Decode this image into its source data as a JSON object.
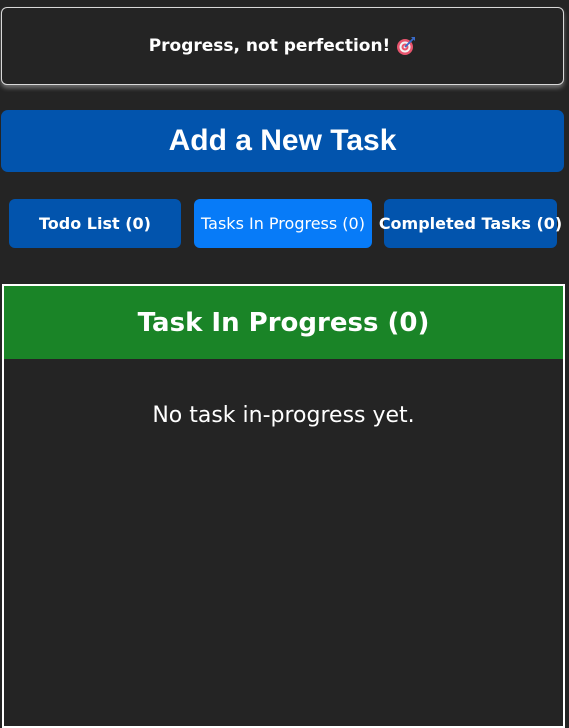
{
  "banner": {
    "message": "Progress, not perfection!",
    "icon": "target-icon"
  },
  "add_button_label": "Add a New Task",
  "tabs": [
    {
      "label": "Todo List (0)",
      "active": false
    },
    {
      "label": "Tasks In Progress (0)",
      "active": true
    },
    {
      "label": "Completed Tasks (0)",
      "active": false
    }
  ],
  "panel": {
    "title": "Task In Progress (0)",
    "empty_message": "No task in-progress yet."
  },
  "colors": {
    "background": "#242424",
    "primary_blue": "#0254ad",
    "active_blue": "#077bf8",
    "header_green": "#1a8427"
  }
}
